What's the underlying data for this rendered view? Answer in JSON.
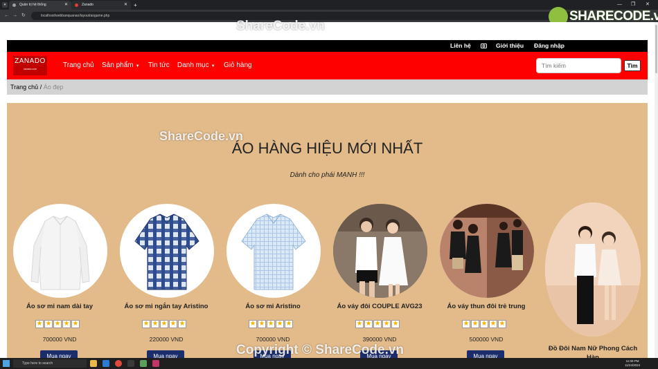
{
  "browser": {
    "tabs": [
      {
        "title": "Quản trị hệ thống"
      },
      {
        "title": "Zanado"
      }
    ],
    "new_tab": "+",
    "url": "localhost/webbanquanao/layout/aogame.php"
  },
  "watermarks": {
    "top": "ShareCode.vn",
    "middle": "ShareCode.vn",
    "bottom": "Copyright © ShareCode.vn",
    "logo": "SHARECODE.vn"
  },
  "topbar": {
    "contact": "Liên hệ",
    "about": "Giới thiệu",
    "login": "Đăng nhập",
    "icon": "camera-icon"
  },
  "navbar": {
    "logo_title": "ZANADO",
    "logo_sub": "zanado.com",
    "items": [
      {
        "label": "Trang chủ"
      },
      {
        "label": "Sản phẩm"
      },
      {
        "label": "Tin tức"
      },
      {
        "label": "Danh mục"
      },
      {
        "label": "Giỏ hàng"
      }
    ],
    "search_placeholder": "Tìm kiếm",
    "search_button": "Tìm",
    "color": "#ff0000"
  },
  "breadcrumb": {
    "home": "Trang chủ",
    "separator": " / ",
    "current": "Áo đẹp"
  },
  "section": {
    "title": "ÁO HÀNG HIỆU MỚI NHẤT",
    "subtitle": "Dành cho phái MẠNH !!!",
    "background": "#e3bb8a"
  },
  "products": [
    {
      "name": "Áo sơ mi nam dài tay",
      "price": "700000 VND",
      "rating": 5,
      "buy": "Mua ngay",
      "image": "white-long-sleeve-shirt"
    },
    {
      "name": "Áo sơ mi ngắn tay Aristino",
      "price": "220000 VND",
      "rating": 5,
      "buy": "Mua ngay",
      "image": "blue-plaid-short-sleeve-shirt"
    },
    {
      "name": "Áo sơ mi Aristino",
      "price": "700000 VND",
      "rating": 5,
      "buy": "Mua ngay",
      "image": "light-blue-check-shirt"
    },
    {
      "name": "Áo váy đôi COUPLE AVG23",
      "price": "390000 VND",
      "rating": 5,
      "buy": "Mua ngay",
      "image": "couple-white-outfit-photo"
    },
    {
      "name": "Áo váy thun đôi trẻ trung",
      "price": "500000 VND",
      "rating": 5,
      "buy": "Mua ngay",
      "image": "couple-black-tshirt-photo"
    },
    {
      "name": "Đồ Đôi Nam Nữ Phong Cách Hàn",
      "image": "couple-korean-style-photo"
    }
  ],
  "taskbar": {
    "search_placeholder": "Type here to search",
    "time": "11:09 PM",
    "date": "11/24/2024"
  }
}
